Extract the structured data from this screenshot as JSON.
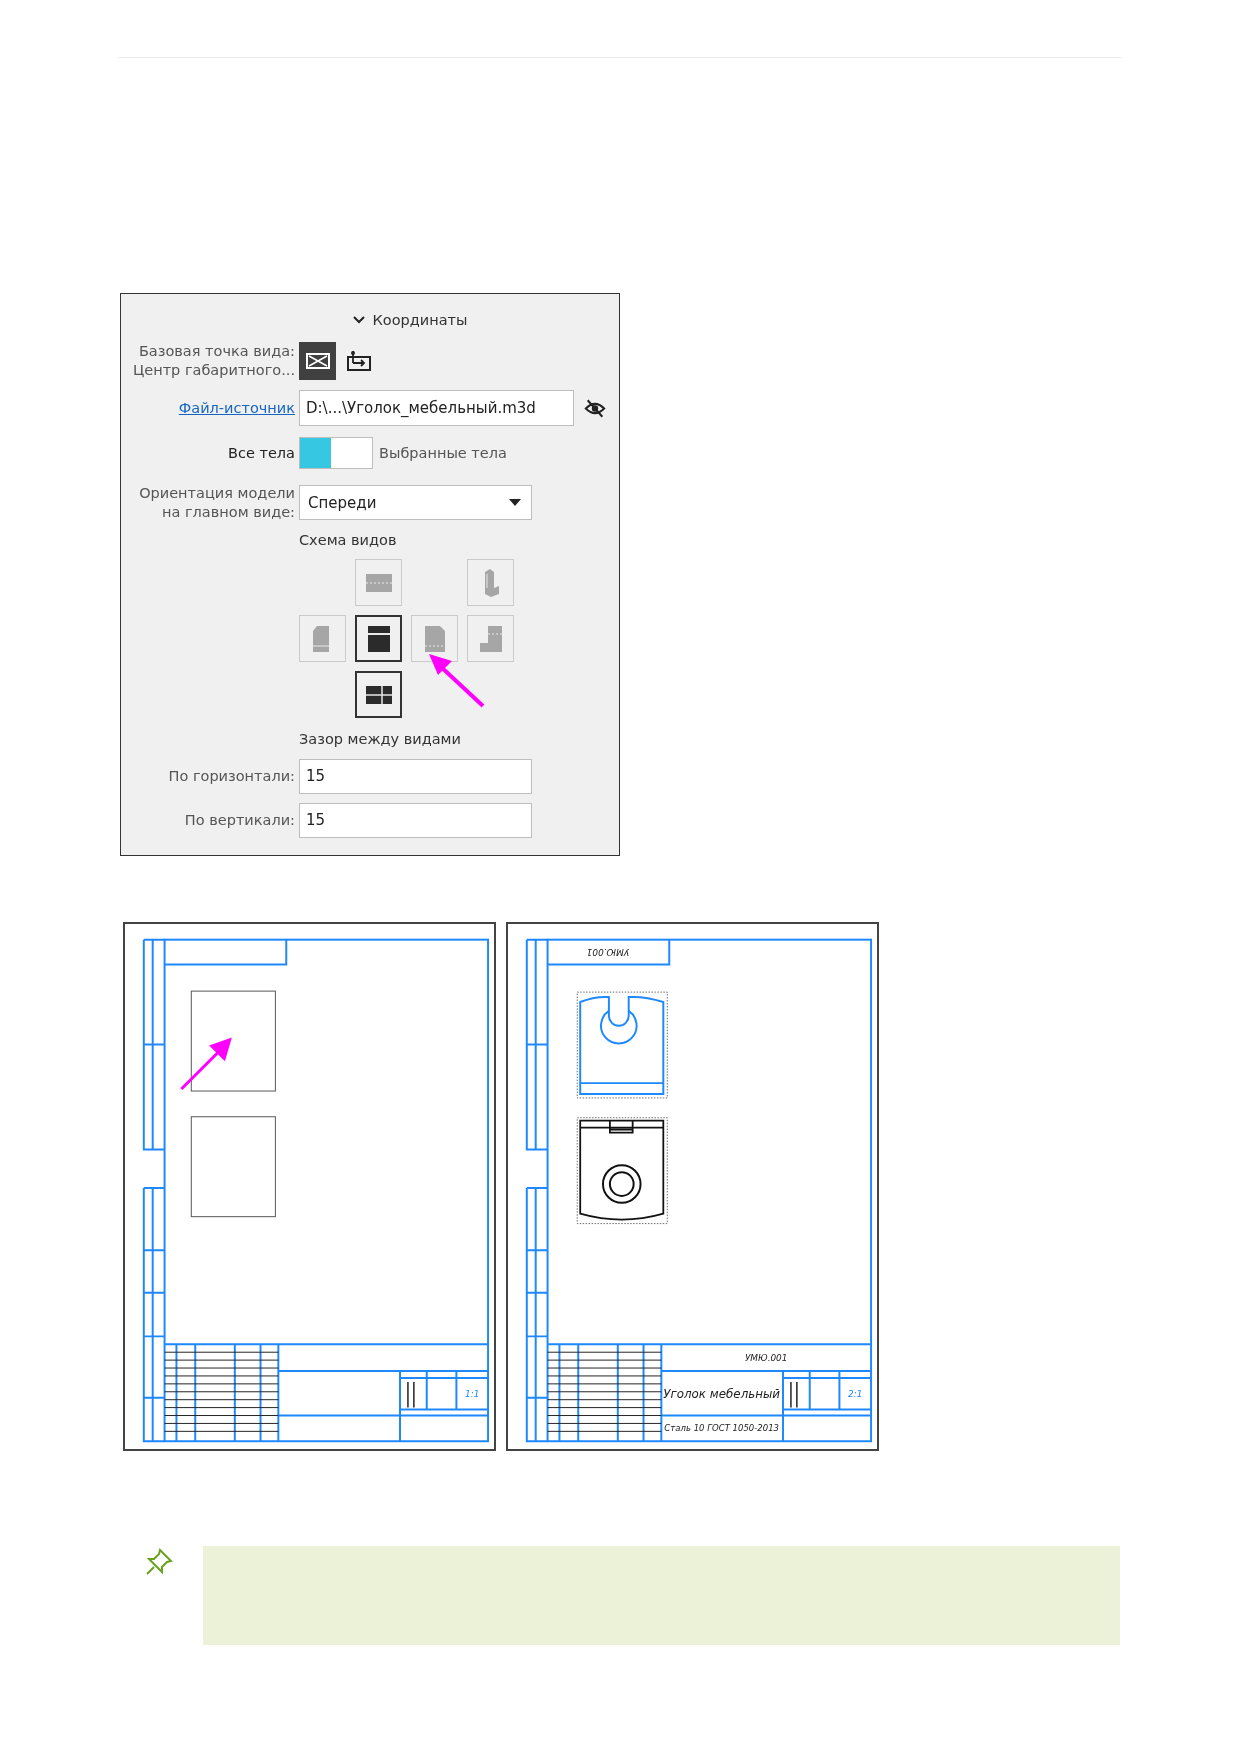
{
  "panel": {
    "section": {
      "title": "Координаты",
      "expanded": true
    },
    "base_point": {
      "label_lines": [
        "Базовая точка вида:",
        "Центр габаритного..."
      ],
      "options": [
        {
          "kind": "center",
          "selected": true
        },
        {
          "kind": "origin",
          "selected": false
        }
      ]
    },
    "source_file": {
      "link": "Файл-источник",
      "value": "D:\\...\\Уголок_мебельный.m3d"
    },
    "bodies": {
      "left_label": "Все тела",
      "right_label": "Выбранные тела",
      "on": false
    },
    "orientation": {
      "label_lines": [
        "Ориентация модели",
        "на главном виде:"
      ],
      "value": "Спереди"
    },
    "scheme": {
      "title": "Схема видов",
      "rows": [
        [
          null,
          {
            "kind": "top",
            "selected": false
          },
          null,
          {
            "kind": "iso",
            "selected": false
          }
        ],
        [
          {
            "kind": "left",
            "selected": false
          },
          {
            "kind": "front",
            "selected": true
          },
          {
            "kind": "right",
            "selected": false
          },
          {
            "kind": "rear",
            "selected": false
          }
        ],
        [
          null,
          {
            "kind": "bottom",
            "selected": true
          },
          null,
          null
        ]
      ]
    },
    "gap": {
      "title": "Зазор между видами",
      "fields": [
        {
          "label": "По горизонтали:",
          "value": "15"
        },
        {
          "label": "По вертикали:",
          "value": "15"
        }
      ]
    }
  },
  "sheets": [
    {
      "views": [
        {
          "kind": "placeholder"
        },
        {
          "kind": "placeholder"
        }
      ],
      "scale": "1:1",
      "arrow": true
    },
    {
      "stamp": "УМЮ.001",
      "designation": "УМЮ.001",
      "name": "Уголок мебельный",
      "material": "Сталь 10 ГОСТ 1050-2013",
      "scale": "2:1",
      "views": [
        {
          "kind": "part-front"
        },
        {
          "kind": "part-top"
        }
      ],
      "arrow": false
    }
  ],
  "note": {
    "kind": "pin"
  }
}
